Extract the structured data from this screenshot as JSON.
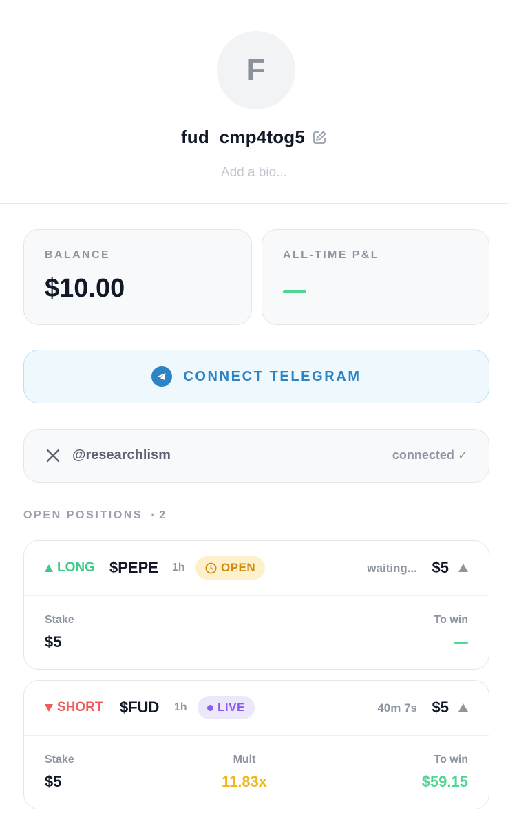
{
  "profile": {
    "avatar_initial": "F",
    "username": "fud_cmp4tog5",
    "bio_placeholder": "Add a bio..."
  },
  "stats": {
    "balance_label": "BALANCE",
    "balance_value": "$10.00",
    "pnl_label": "ALL-TIME P&L"
  },
  "telegram": {
    "button_label": "CONNECT TELEGRAM"
  },
  "x_account": {
    "handle": "@researchlism",
    "status": "connected ✓"
  },
  "positions": {
    "title": "OPEN POSITIONS",
    "count": "· 2",
    "items": [
      {
        "direction": "LONG",
        "ticker": "$PEPE",
        "timeframe": "1h",
        "badge": "OPEN",
        "status": "waiting...",
        "amount": "$5",
        "stake_label": "Stake",
        "stake_value": "$5",
        "towin_label": "To win"
      },
      {
        "direction": "SHORT",
        "ticker": "$FUD",
        "timeframe": "1h",
        "badge": "LIVE",
        "status": "40m 7s",
        "amount": "$5",
        "stake_label": "Stake",
        "stake_value": "$5",
        "mult_label": "Mult",
        "mult_value": "11.83x",
        "towin_label": "To win",
        "towin_value": "$59.15"
      }
    ]
  },
  "colors": {
    "long": "#3ec98a",
    "short": "#ef5c5c",
    "telegram": "#2b84c6",
    "open_badge": "#d08a10",
    "live_badge": "#8b5ce6",
    "mult": "#f0b81c"
  }
}
